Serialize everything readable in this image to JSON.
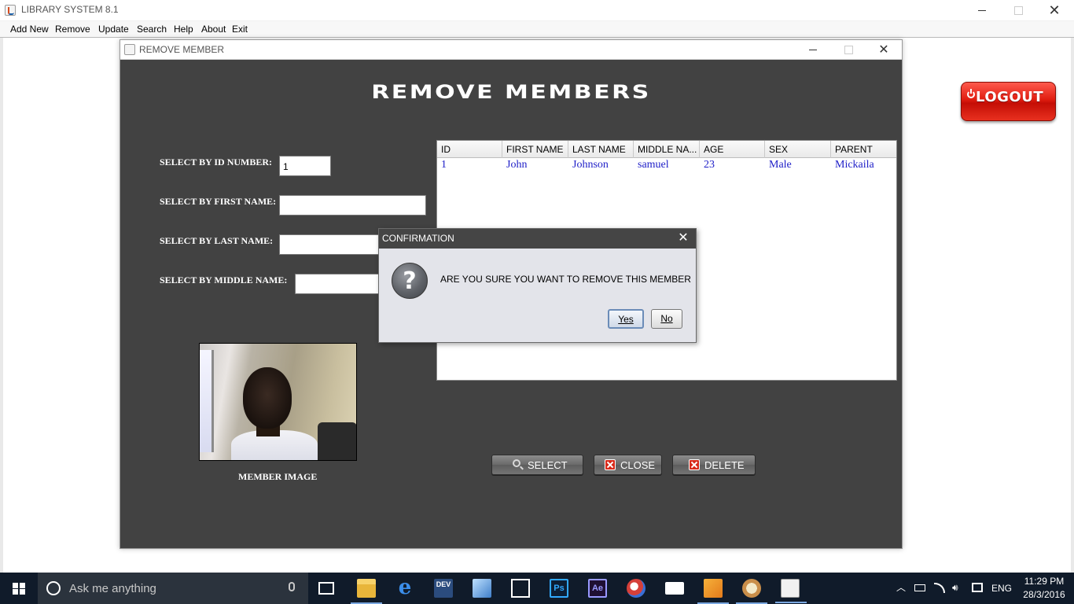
{
  "app": {
    "title": "LIBRARY SYSTEM 8.1",
    "menu": [
      "Add New",
      "Remove",
      "Update",
      "Search",
      "Help",
      "About",
      "Exit"
    ]
  },
  "logout": {
    "label": "LOGOUT"
  },
  "remove_frame": {
    "title": "REMOVE MEMBER",
    "heading": "REMOVE MEMBERS",
    "fields": {
      "id_label": "SELECT BY ID NUMBER:",
      "id_value": "1",
      "first_label": "SELECT BY FIRST NAME:",
      "first_value": "",
      "last_label": "SELECT BY LAST NAME:",
      "last_value": "",
      "middle_label": "SELECT BY MIDDLE NAME:",
      "middle_value": ""
    },
    "image_label": "MEMBER IMAGE",
    "table": {
      "columns": [
        "ID",
        "FIRST NAME",
        "LAST NAME",
        "MIDDLE NA...",
        "AGE",
        "SEX",
        "PARENT"
      ],
      "rows": [
        [
          "1",
          "John",
          "Johnson",
          "samuel",
          "23",
          "Male",
          "Mickaila"
        ]
      ]
    },
    "buttons": {
      "select": "SELECT",
      "close": "CLOSE",
      "delete": "DELETE"
    }
  },
  "dialog": {
    "title": "CONFIRMATION",
    "message": "ARE YOU SURE YOU WANT TO REMOVE THIS MEMBER",
    "yes": "Yes",
    "no": "No",
    "icon": "question-icon"
  },
  "taskbar": {
    "search_placeholder": "Ask me anything",
    "apps": [
      "task-view-icon",
      "file-explorer-icon",
      "edge-icon",
      "dev-cpp-icon",
      "virtualbox-icon",
      "store-icon",
      "photoshop-icon",
      "after-effects-icon",
      "browser-icon",
      "mail-icon",
      "media-player-icon",
      "paint-icon",
      "java-icon"
    ],
    "tray": {
      "lang": "ENG",
      "time": "11:29 PM",
      "date": "28/3/2016"
    }
  },
  "colors": {
    "frame_bg": "#424242",
    "table_text": "#2020c8",
    "logout": "#e01d10",
    "taskbar": "#101b2a"
  }
}
